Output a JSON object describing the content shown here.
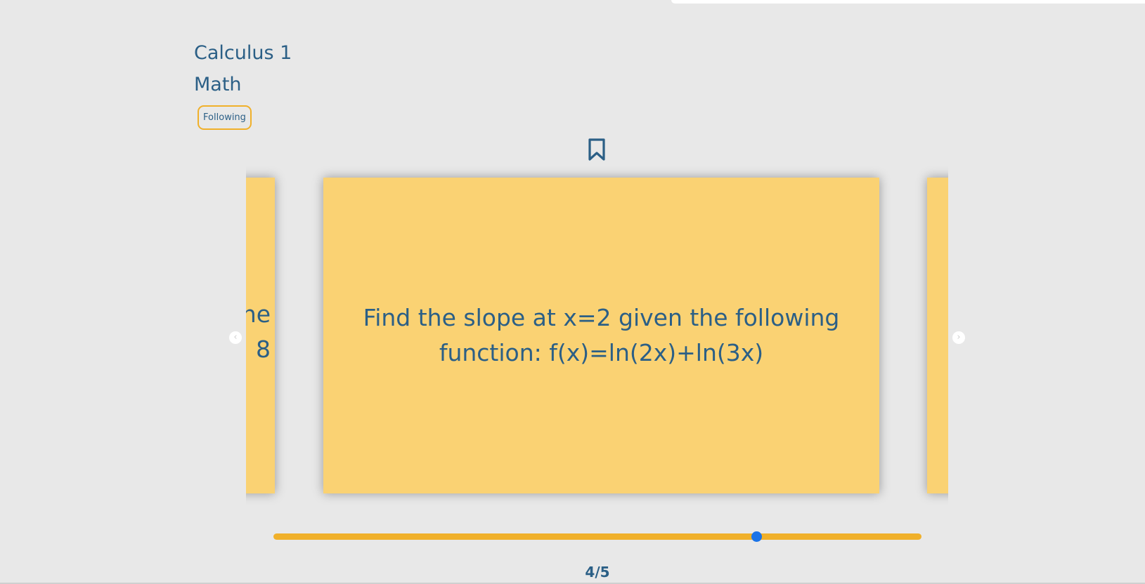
{
  "course": {
    "title": "Calculus 1",
    "subject": "Math",
    "follow_label": "Following"
  },
  "cards": {
    "prev_lines": [
      "ne",
      "8"
    ],
    "current_text": "Find the slope at x=2 given the following function: f(x)=ln(2x)+ln(3x)",
    "next_text": ""
  },
  "navigation": {
    "prev_icon": "chevron-left-icon",
    "next_icon": "chevron-right-icon",
    "bookmark_icon": "bookmark-icon"
  },
  "progress": {
    "counter": "4/5",
    "fraction": 0.745
  },
  "colors": {
    "background": "#e8e8e8",
    "card": "#fad273",
    "text": "#2b5f86",
    "accent": "#f0b02a",
    "thumb": "#1a73e8"
  }
}
